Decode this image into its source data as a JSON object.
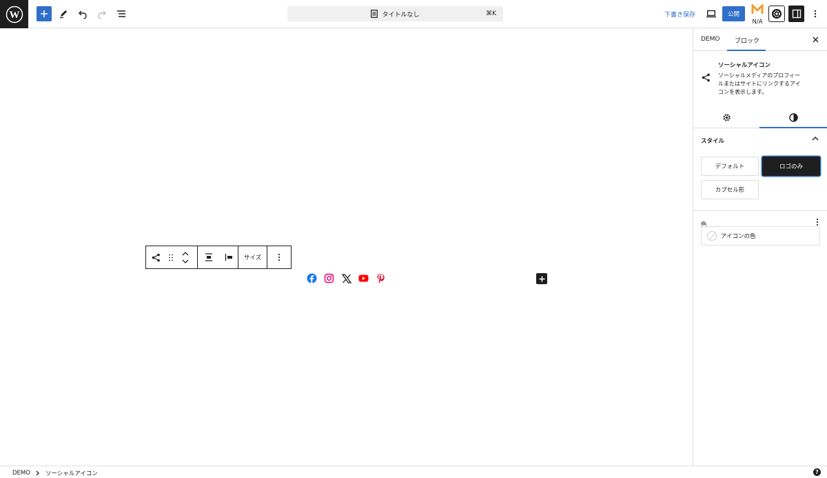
{
  "topbar": {
    "document_title": "タイトルなし",
    "shortcut": "⌘K",
    "save_draft": "下書き保存",
    "publish": "公開",
    "plugin_status": "N/A",
    "icons": [
      "wordpress-logo",
      "add-block",
      "edit-tool",
      "undo",
      "redo",
      "document-overview",
      "preview-desktop",
      "plugin-logo",
      "plugin-gear",
      "sidebar-toggle",
      "more-options"
    ]
  },
  "block_toolbar": {
    "size_label": "サイズ"
  },
  "social_icons": [
    {
      "name": "facebook",
      "color": "#1877f2"
    },
    {
      "name": "instagram",
      "color": "#f00075"
    },
    {
      "name": "x",
      "color": "#1e1e1e"
    },
    {
      "name": "youtube",
      "color": "#ff0000"
    },
    {
      "name": "pinterest",
      "color": "#e60122"
    }
  ],
  "sidebar": {
    "tabs": [
      "DEMO",
      "ブロック"
    ],
    "block_title": "ソーシャルアイコン",
    "block_description": "ソーシャルメディアのプロフィールまたはサイトにリンクするアイコンを表示します。",
    "style_panel": {
      "label": "スタイル",
      "options": [
        "デフォルト",
        "ロゴのみ",
        "カプセル形"
      ],
      "selected": "ロゴのみ"
    },
    "color_panel": {
      "label": "色",
      "item": "アイコンの色"
    }
  },
  "footer": {
    "breadcrumb": [
      "DEMO",
      "ソーシャルアイコン"
    ],
    "help": "?"
  },
  "colors": {
    "accent": "#2f6fc9",
    "dark": "#1e1e1e"
  }
}
